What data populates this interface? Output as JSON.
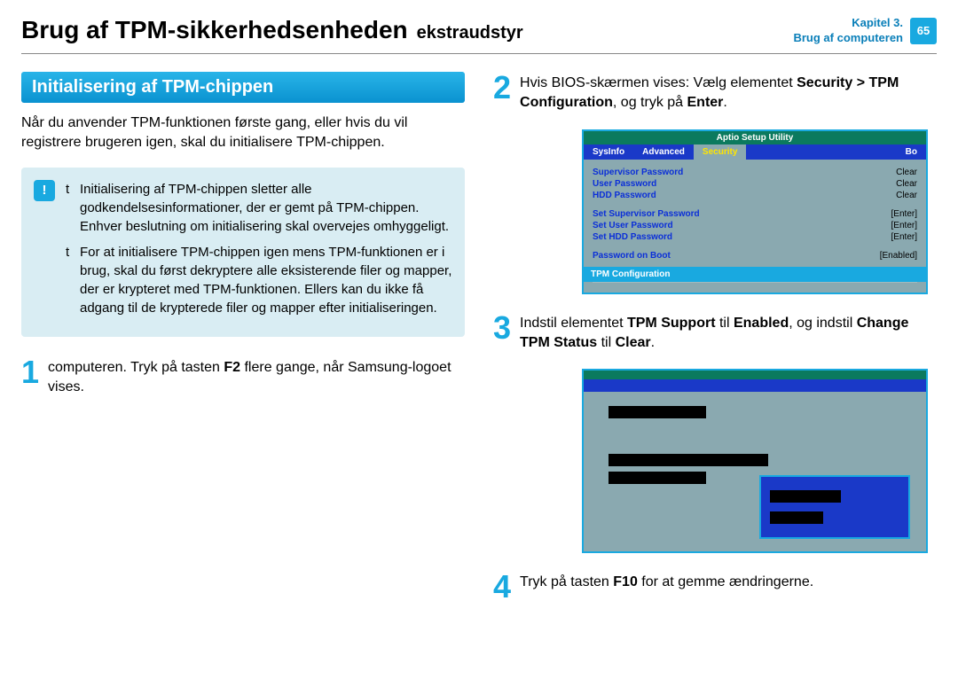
{
  "header": {
    "title_main": "Brug af TPM-sikkerhedsenheden",
    "title_sub": "ekstraudstyr",
    "chapter_line1": "Kapitel 3.",
    "chapter_line2": "Brug af computeren",
    "page_number": "65"
  },
  "left": {
    "section_title": "Initialisering af TPM-chippen",
    "intro": "Når du anvender TPM-funktionen første gang, eller hvis du vil registrere brugeren igen, skal du initialisere TPM-chippen.",
    "notice": {
      "bullet": "t",
      "item1": "Initialisering af TPM-chippen sletter alle godkendelsesinformationer, der er gemt på TPM-chippen. Enhver beslutning om initialisering skal overvejes omhyggeligt.",
      "item2": "For at initialisere TPM-chippen igen mens TPM-funktionen er i brug, skal du først dekryptere alle eksisterende filer og mapper, der er krypteret med TPM-funktionen. Ellers kan du ikke få adgang til de krypterede filer og mapper efter initialiseringen."
    },
    "step1": {
      "num": "1",
      "text_pre": "computeren. Tryk på tasten ",
      "f2": "F2",
      "text_post": " flere gange, når Samsung-logoet vises."
    }
  },
  "right": {
    "step2": {
      "num": "2",
      "pre": "Hvis BIOS-skærmen vises: Vælg elementet ",
      "b1": "Security > TPM Configuration",
      "mid": ", og tryk på ",
      "b2": "Enter",
      "post": "."
    },
    "bios": {
      "title": "Aptio Setup Utility",
      "tabs": {
        "t1": "SysInfo",
        "t2": "Advanced",
        "t3": "Security",
        "t4": "Bo"
      },
      "rows": [
        {
          "label": "Supervisor Password",
          "val": "Clear"
        },
        {
          "label": "User Password",
          "val": "Clear"
        },
        {
          "label": "HDD Password",
          "val": "Clear"
        }
      ],
      "rows2": [
        {
          "label": "Set Supervisor Password",
          "val": "[Enter]"
        },
        {
          "label": "Set User Password",
          "val": "[Enter]"
        },
        {
          "label": "Set HDD Password",
          "val": "[Enter]"
        }
      ],
      "rows3": [
        {
          "label": "Password on Boot",
          "val": "[Enabled]"
        }
      ],
      "selected": "TPM Configuration"
    },
    "step3": {
      "num": "3",
      "pre": "Indstil elementet ",
      "b1": "TPM Support",
      "mid1": " til ",
      "b2": "Enabled",
      "mid2": ", og indstil ",
      "b3": "Change TPM Status",
      "mid3": " til ",
      "b4": "Clear",
      "post": "."
    },
    "step4": {
      "num": "4",
      "pre": "Tryk på tasten ",
      "b1": "F10",
      "post": " for at gemme ændringerne."
    }
  }
}
